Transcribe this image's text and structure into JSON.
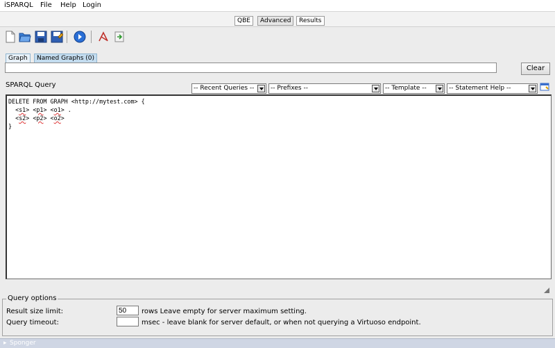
{
  "menu": {
    "app_name": "iSPARQL",
    "items": [
      "File",
      "Help",
      "Login"
    ]
  },
  "view_tabs": {
    "qbe": "QBE",
    "advanced": "Advanced",
    "results": "Results",
    "selected": "Advanced"
  },
  "toolbar": {
    "icons": [
      "new-document-icon",
      "open-folder-icon",
      "save-icon",
      "save-as-icon",
      "execute-icon",
      "visualize-icon",
      "export-icon"
    ]
  },
  "graph_tabs": {
    "graph": "Graph",
    "named_graphs": "Named Graphs (0)"
  },
  "graph_input": {
    "value": ""
  },
  "clear_button": "Clear",
  "sparql_query_label": "SPARQL Query",
  "dropdowns": {
    "recent": "-- Recent  Queries --",
    "prefixes": "-- Prefixes --",
    "template": "-- Template --",
    "statement_help": "-- Statement  Help --"
  },
  "query": {
    "line1": "DELETE FROM GRAPH <http://mytest.com> {",
    "line2_pre": "  <",
    "s1": "s1",
    "line2_a": "> <",
    "p1": "p1",
    "line2_b": "> <",
    "o1": "o1",
    "line2_end": "> .",
    "line3_pre": "  <",
    "s2": "s2",
    "line3_a": "> <",
    "p2": "p2",
    "line3_b": "> <",
    "o2": "o2",
    "line3_end": ">",
    "line4": "}"
  },
  "query_options": {
    "legend": "Query options",
    "result_size_label": "Result size limit:",
    "result_size_value": "50",
    "result_size_hint": "rows Leave empty for server maximum setting.",
    "timeout_label": "Query timeout:",
    "timeout_value": "",
    "timeout_hint": "msec - leave blank for server default, or when not querying a Virtuoso endpoint."
  },
  "sponger": "Sponger",
  "colors": {
    "panel": "#ececec",
    "graph_tab": "#e8f1f8",
    "named_graphs_tab": "#c3dcef",
    "execute_blue": "#2a6fd6"
  }
}
